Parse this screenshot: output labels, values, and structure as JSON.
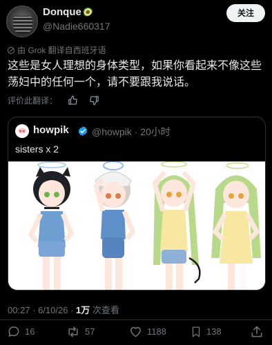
{
  "author": {
    "display_name": "Donque",
    "emoji": "avocado",
    "handle": "@Nadie660317"
  },
  "follow_label": "关注",
  "translation_note": "由 Grok 翻译自西班牙语",
  "tweet_text": "这些是女人理想的身体类型，如果你看起来不像这些荡妇中的任何一个，请不要跟我说话。",
  "rate_label": "评价此翻译：",
  "quote": {
    "name": "howpik",
    "verified": true,
    "handle_time": "@howpik · 20小时",
    "text": "sisters x 2",
    "image_description_icon": "anime-illustration"
  },
  "timestamp": {
    "time_date": "00:27 · 6/10/26 · ",
    "views_count": "1万",
    "views_label": " 次查看"
  },
  "actions": {
    "replies": "16",
    "reposts": "57",
    "likes": "1188",
    "bookmarks": "138"
  },
  "colors": {
    "background": "#000000",
    "text": "#e7e9ea",
    "muted": "#71767b",
    "border": "#2f3336",
    "verified": "#1d9bf0"
  }
}
